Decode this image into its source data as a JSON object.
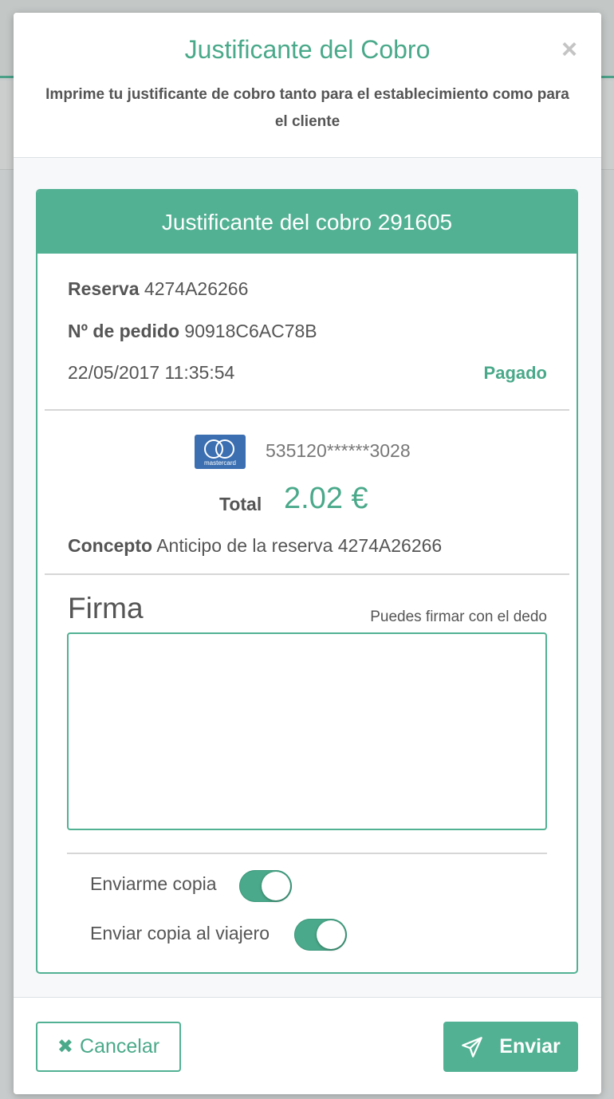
{
  "modal": {
    "title": "Justificante del Cobro",
    "close_symbol": "×",
    "subtitle": "Imprime tu justificante de cobro tanto para el establecimiento como para el cliente"
  },
  "receipt": {
    "header": "Justificante del cobro 291605",
    "reservation_label": "Reserva",
    "reservation_value": "4274A26266",
    "order_label": "Nº de pedido",
    "order_value": "90918C6AC78B",
    "datetime": "22/05/2017 11:35:54",
    "status": "Pagado",
    "card_brand_label": "mastercard",
    "card_number": "535120******3028",
    "total_label": "Total",
    "total_value": "2.02 €",
    "concept_label": "Concepto",
    "concept_value": "Anticipo de la reserva 4274A26266"
  },
  "signature": {
    "title": "Firma",
    "hint": "Puedes firmar con el dedo"
  },
  "toggles": [
    {
      "label": "Enviarme copia",
      "on": true
    },
    {
      "label": "Enviar copia al viajero",
      "on": true
    }
  ],
  "footer": {
    "cancel_icon": "✖",
    "cancel_label": "Cancelar",
    "send_label": "Enviar"
  },
  "colors": {
    "accent": "#52b193",
    "accent_text": "#4aa98a"
  },
  "icons": {
    "close": "close-icon",
    "card": "mastercard-icon",
    "cancel": "cross-icon",
    "send": "paper-plane-icon"
  }
}
